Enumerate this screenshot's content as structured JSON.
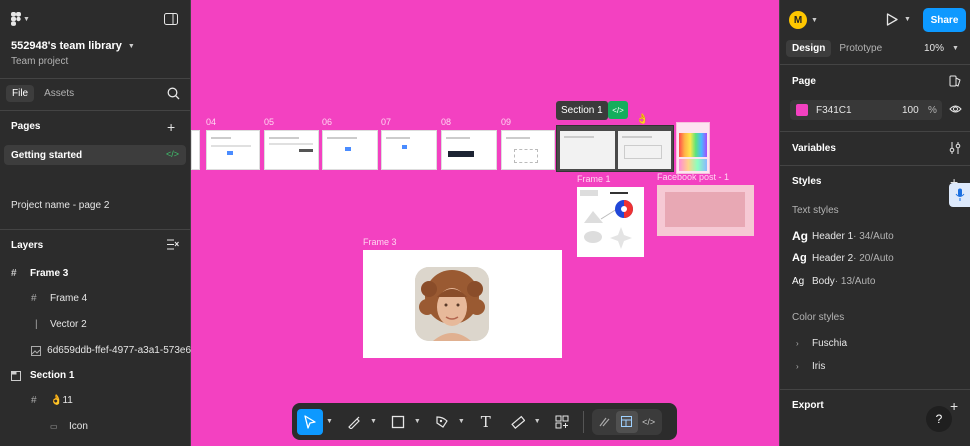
{
  "app": {
    "accent": "#0D99FF",
    "canvas_color": "#F341C1"
  },
  "left": {
    "team_name": "552948's team library",
    "team_sub": "Team project",
    "tabs": {
      "file": "File",
      "assets": "Assets"
    },
    "pages_title": "Pages",
    "pages": [
      "Getting started",
      "Project name - page 2"
    ],
    "layers_title": "Layers",
    "layers": [
      "Frame 3",
      "Frame 4",
      "Vector 2",
      "6d659ddb-ffef-4977-a3a1-573e6",
      "Section 1",
      "👌11",
      "Icon"
    ]
  },
  "canvas": {
    "frame_numbers": [
      "04",
      "05",
      "06",
      "07",
      "08",
      "09"
    ],
    "section_label": "Section 1",
    "frame1_label": "Frame 1",
    "facebook_label": "Facebook post - 1",
    "frame3_label": "Frame 3"
  },
  "right": {
    "avatar_letter": "M",
    "share_label": "Share",
    "tabs": {
      "design": "Design",
      "prototype": "Prototype"
    },
    "zoom": "10%",
    "page_title": "Page",
    "page_color_hex": "F341C1",
    "page_opacity": "100",
    "page_opacity_unit": "%",
    "variables_title": "Variables",
    "styles_title": "Styles",
    "text_styles_title": "Text styles",
    "text_styles": [
      {
        "glyph": "Ag",
        "name": "Header 1",
        "meta": " · 34/Auto"
      },
      {
        "glyph": "Ag",
        "name": "Header 2",
        "meta": " · 20/Auto"
      },
      {
        "glyph": "Ag",
        "name": "Body",
        "meta": " · 13/Auto"
      }
    ],
    "color_styles_title": "Color styles",
    "color_styles": [
      "Fuschia",
      "Iris"
    ],
    "export_title": "Export",
    "help": "?"
  }
}
